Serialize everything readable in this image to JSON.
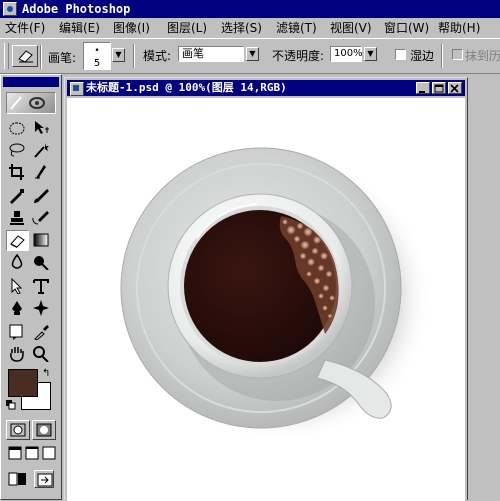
{
  "app": {
    "title": "Adobe Photoshop",
    "icon": "photoshop-app-icon"
  },
  "menu": [
    "文件(F)",
    "编辑(E)",
    "图像(I)",
    "图层(L)",
    "选择(S)",
    "滤镜(T)",
    "视图(V)",
    "窗口(W)",
    "帮助(H)"
  ],
  "options": {
    "brush_label": "画笔:",
    "brush_size": "5",
    "mode_label": "模式:",
    "mode_value": "画笔",
    "opacity_label": "不透明度:",
    "opacity_value": "100%",
    "wet_edges_label": "湿边",
    "erase_history_label": "抹到历"
  },
  "document": {
    "title": "未标题-1.psd @ 100%(图层 14,RGB)"
  },
  "colors": {
    "foreground": "#4a2d22",
    "background": "#ffffff",
    "titlebar": "#000080",
    "coffee": "#2a0f0a",
    "saucer": "#c9cccb"
  },
  "tools": [
    "marquee-tool",
    "move-tool",
    "lasso-tool",
    "magic-wand-tool",
    "crop-tool",
    "slice-tool",
    "healing-brush-tool",
    "brush-tool",
    "clone-stamp-tool",
    "history-brush-tool",
    "eraser-tool",
    "gradient-tool",
    "blur-tool",
    "dodge-tool",
    "path-selection-tool",
    "type-tool",
    "pen-tool",
    "shape-tool",
    "notes-tool",
    "eyedropper-tool",
    "hand-tool",
    "zoom-tool"
  ]
}
